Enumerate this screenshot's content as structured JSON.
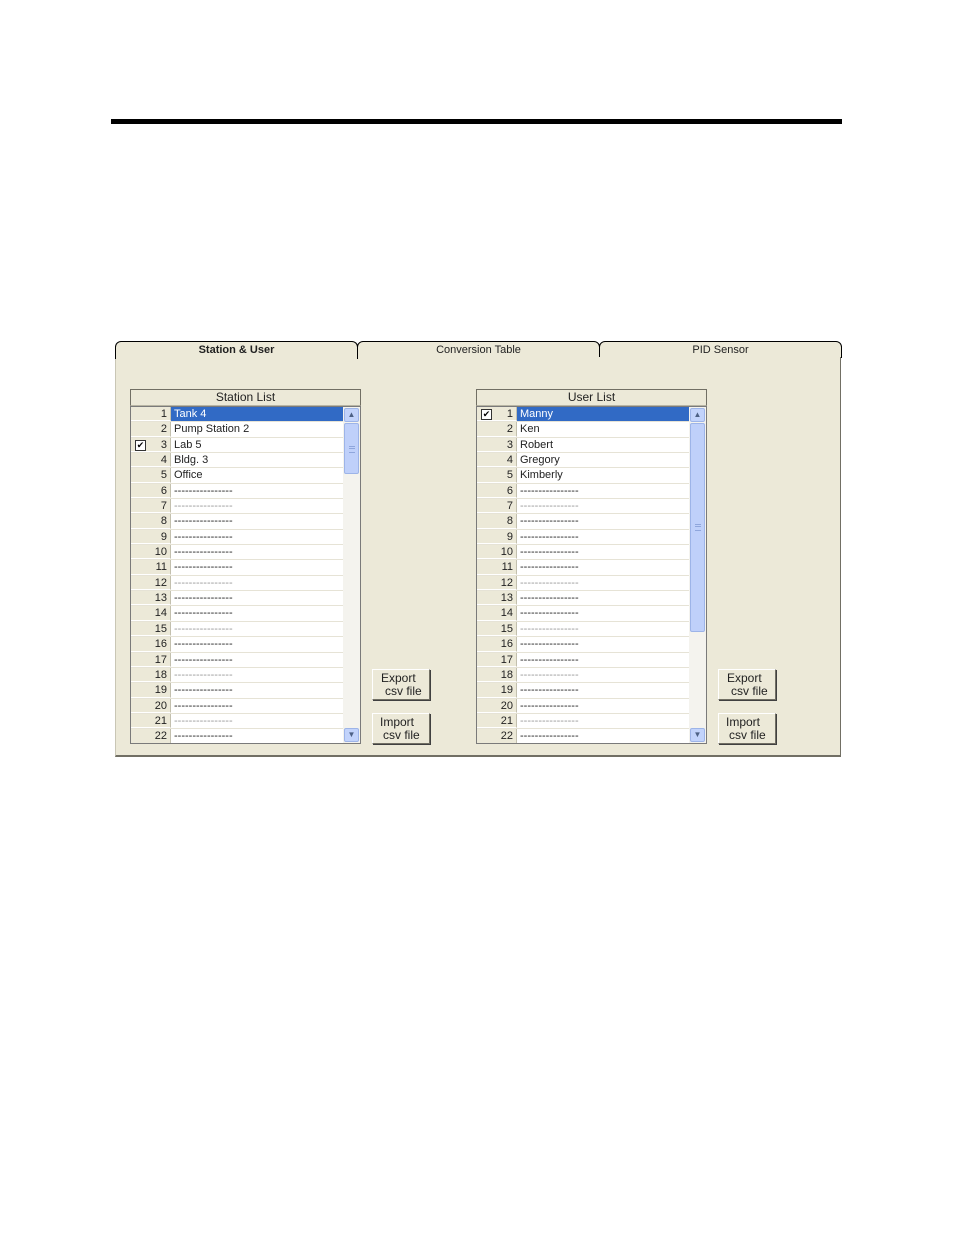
{
  "tabs": [
    {
      "label": "Station & User",
      "active": true
    },
    {
      "label": "Conversion Table",
      "active": false
    },
    {
      "label": "PID Sensor",
      "active": false
    }
  ],
  "station_list": {
    "header": "Station List",
    "selected_row": 1,
    "rows": [
      {
        "num": "1",
        "name": "Tank 4",
        "checked": false,
        "faint": false
      },
      {
        "num": "2",
        "name": "Pump Station 2",
        "checked": false,
        "faint": false
      },
      {
        "num": "3",
        "name": "Lab 5",
        "checked": true,
        "faint": false
      },
      {
        "num": "4",
        "name": "Bldg. 3",
        "checked": false,
        "faint": false
      },
      {
        "num": "5",
        "name": "Office",
        "checked": false,
        "faint": false
      },
      {
        "num": "6",
        "name": "----------------",
        "checked": false,
        "faint": false
      },
      {
        "num": "7",
        "name": "----------------",
        "checked": false,
        "faint": true
      },
      {
        "num": "8",
        "name": "----------------",
        "checked": false,
        "faint": false
      },
      {
        "num": "9",
        "name": "----------------",
        "checked": false,
        "faint": false
      },
      {
        "num": "10",
        "name": "----------------",
        "checked": false,
        "faint": false
      },
      {
        "num": "11",
        "name": "----------------",
        "checked": false,
        "faint": false
      },
      {
        "num": "12",
        "name": "----------------",
        "checked": false,
        "faint": true
      },
      {
        "num": "13",
        "name": "----------------",
        "checked": false,
        "faint": false
      },
      {
        "num": "14",
        "name": "----------------",
        "checked": false,
        "faint": false
      },
      {
        "num": "15",
        "name": "----------------",
        "checked": false,
        "faint": true
      },
      {
        "num": "16",
        "name": "----------------",
        "checked": false,
        "faint": false
      },
      {
        "num": "17",
        "name": "----------------",
        "checked": false,
        "faint": false
      },
      {
        "num": "18",
        "name": "----------------",
        "checked": false,
        "faint": true
      },
      {
        "num": "19",
        "name": "----------------",
        "checked": false,
        "faint": false
      },
      {
        "num": "20",
        "name": "----------------",
        "checked": false,
        "faint": false
      },
      {
        "num": "21",
        "name": "----------------",
        "checked": false,
        "faint": true
      },
      {
        "num": "22",
        "name": "----------------",
        "checked": false,
        "faint": false
      }
    ],
    "scroll_position": 0,
    "export_button": [
      "Export",
      "csv file"
    ],
    "import_button": [
      "Import",
      "csv file"
    ]
  },
  "user_list": {
    "header": "User List",
    "selected_row": 1,
    "rows": [
      {
        "num": "1",
        "name": "Manny",
        "checked": true,
        "faint": false
      },
      {
        "num": "2",
        "name": "Ken",
        "checked": false,
        "faint": false
      },
      {
        "num": "3",
        "name": "Robert",
        "checked": false,
        "faint": false
      },
      {
        "num": "4",
        "name": "Gregory",
        "checked": false,
        "faint": false
      },
      {
        "num": "5",
        "name": "Kimberly",
        "checked": false,
        "faint": false
      },
      {
        "num": "6",
        "name": "----------------",
        "checked": false,
        "faint": false
      },
      {
        "num": "7",
        "name": "----------------",
        "checked": false,
        "faint": true
      },
      {
        "num": "8",
        "name": "----------------",
        "checked": false,
        "faint": false
      },
      {
        "num": "9",
        "name": "----------------",
        "checked": false,
        "faint": false
      },
      {
        "num": "10",
        "name": "----------------",
        "checked": false,
        "faint": false
      },
      {
        "num": "11",
        "name": "----------------",
        "checked": false,
        "faint": false
      },
      {
        "num": "12",
        "name": "----------------",
        "checked": false,
        "faint": true
      },
      {
        "num": "13",
        "name": "----------------",
        "checked": false,
        "faint": false
      },
      {
        "num": "14",
        "name": "----------------",
        "checked": false,
        "faint": false
      },
      {
        "num": "15",
        "name": "----------------",
        "checked": false,
        "faint": true
      },
      {
        "num": "16",
        "name": "----------------",
        "checked": false,
        "faint": false
      },
      {
        "num": "17",
        "name": "----------------",
        "checked": false,
        "faint": false
      },
      {
        "num": "18",
        "name": "----------------",
        "checked": false,
        "faint": true
      },
      {
        "num": "19",
        "name": "----------------",
        "checked": false,
        "faint": false
      },
      {
        "num": "20",
        "name": "----------------",
        "checked": false,
        "faint": false
      },
      {
        "num": "21",
        "name": "----------------",
        "checked": false,
        "faint": true
      },
      {
        "num": "22",
        "name": "----------------",
        "checked": false,
        "faint": false
      }
    ],
    "scroll_position": 0,
    "export_button": [
      "Export",
      "csv file"
    ],
    "import_button": [
      "Import",
      "csv file"
    ]
  },
  "colors": {
    "selection": "#316ac5",
    "panel": "#ece9d8",
    "scrollbar": "#bfd0fa"
  }
}
